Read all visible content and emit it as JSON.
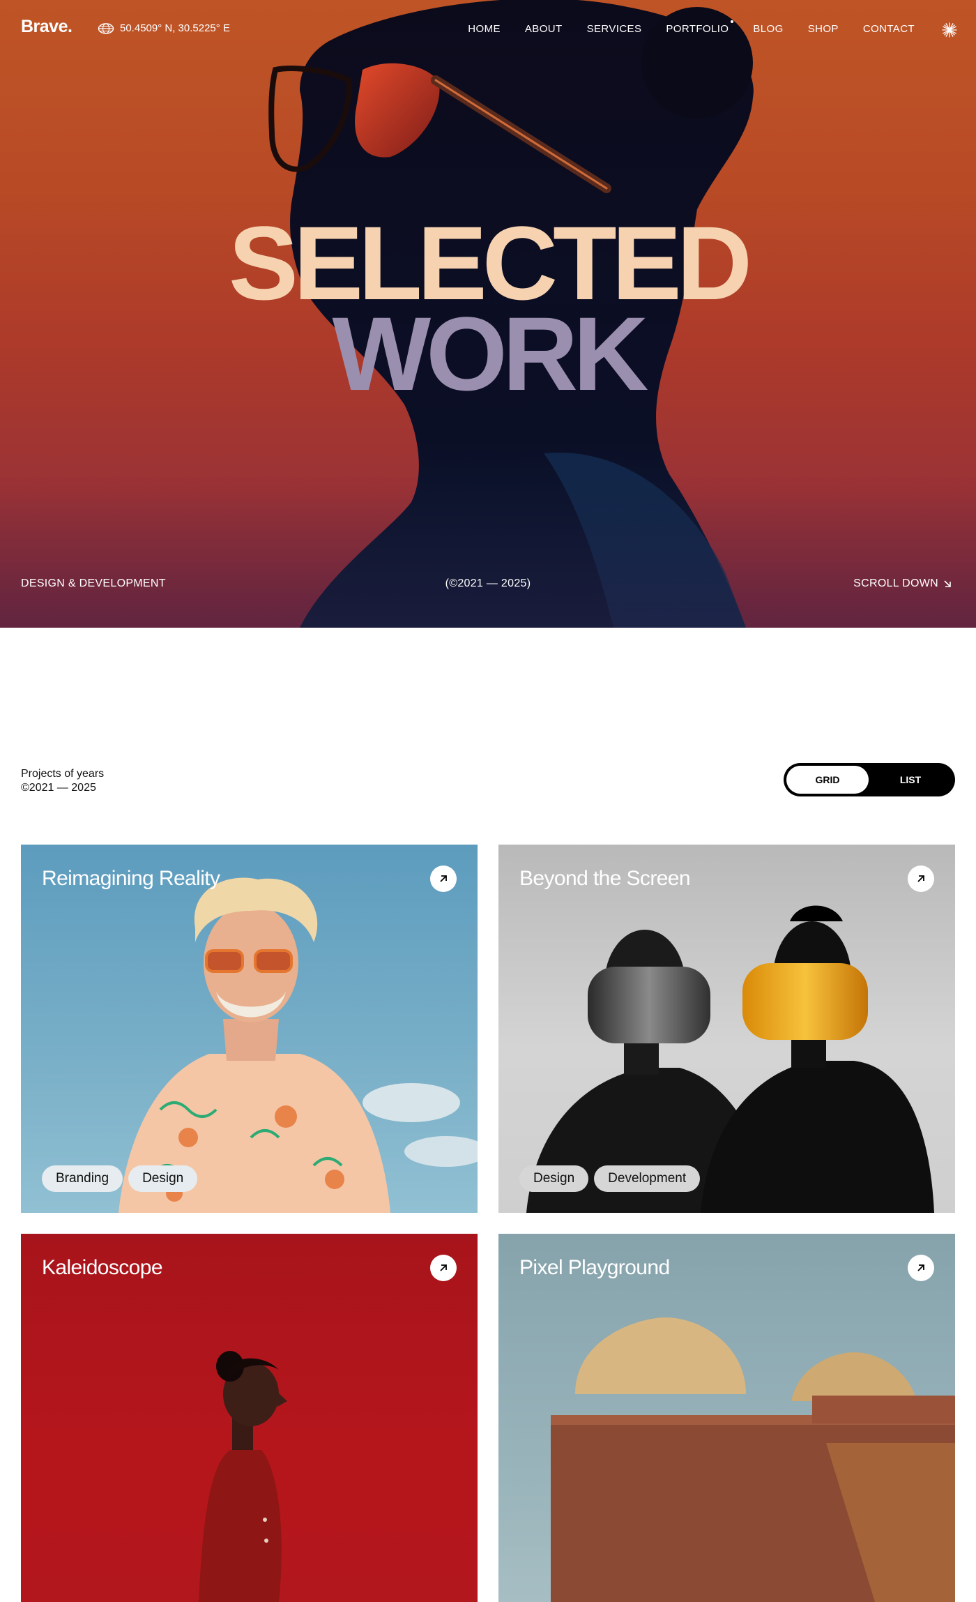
{
  "brand": {
    "logo": "Brave."
  },
  "location": {
    "coordinates": "50.4509° N, 30.5225° E",
    "icon": "globe-icon"
  },
  "nav": {
    "items": [
      {
        "label": "HOME"
      },
      {
        "label": "ABOUT"
      },
      {
        "label": "SERVICES"
      },
      {
        "label": "PORTFOLIO"
      },
      {
        "label": "BLOG"
      },
      {
        "label": "SHOP"
      },
      {
        "label": "CONTACT"
      }
    ],
    "menu_icon": "sunburst-icon"
  },
  "hero": {
    "title_line1": "SELECTED",
    "title_line2": "WORK",
    "left_caption": "DESIGN & DEVELOPMENT",
    "center_caption": "(©2021 — 2025)",
    "right_caption": "SCROLL DOWN",
    "scroll_icon": "arrow-down-right-icon"
  },
  "projects": {
    "heading_line1": "Projects of years",
    "heading_line2": "©2021 — 2025",
    "view_toggle": {
      "grid_label": "GRID",
      "list_label": "LIST",
      "active": "GRID"
    },
    "cards": [
      {
        "title": "Reimagining Reality",
        "tags": [
          "Branding",
          "Design"
        ]
      },
      {
        "title": "Beyond the Screen",
        "tags": [
          "Design",
          "Development"
        ]
      },
      {
        "title": "Kaleidoscope",
        "tags": []
      },
      {
        "title": "Pixel Playground",
        "tags": []
      }
    ]
  },
  "colors": {
    "hero_orange": "#bf5526",
    "hero_title": "#f6d2b0",
    "toggle_bg": "#000000",
    "card1_bg": "#5d9cbe",
    "card3_bg": "#a8141b"
  }
}
